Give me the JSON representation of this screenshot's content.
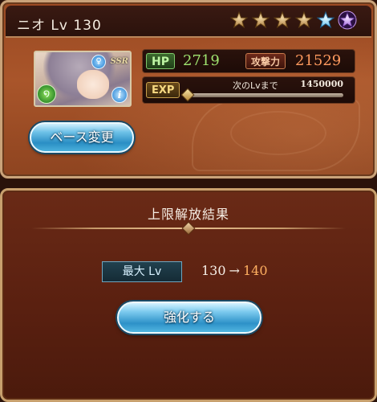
{
  "character": {
    "name": "ニオ",
    "level_label": "Lv",
    "level": "130",
    "rarity": "SSR",
    "stars": [
      {
        "kind": "bronze",
        "icon": "bronze-star-icon"
      },
      {
        "kind": "bronze",
        "icon": "bronze-star-icon"
      },
      {
        "kind": "bronze",
        "icon": "bronze-star-icon"
      },
      {
        "kind": "bronze",
        "icon": "bronze-star-icon"
      },
      {
        "kind": "blue",
        "icon": "blue-star-icon"
      },
      {
        "kind": "purple",
        "icon": "purple-star-icon"
      }
    ],
    "element_icon": "wind-element-icon",
    "gender_icon": "gender-icon",
    "info_icon": "info-icon"
  },
  "stats": {
    "hp_label": "HP",
    "hp_value": "2719",
    "atk_label": "攻撃力",
    "atk_value": "21529",
    "exp_label": "EXP",
    "next_lv_label": "次のLvまで",
    "next_lv_value": "1450000",
    "exp_progress": 0.0
  },
  "buttons": {
    "base_change": "ベース変更",
    "upgrade": "強化する"
  },
  "result": {
    "title": "上限解放結果",
    "max_lv_label": "最大 Lv",
    "from": "130",
    "arrow": "→",
    "to": "140"
  },
  "colors": {
    "panel": "#a9552a",
    "hp": "#9fe36f",
    "atk": "#ff9a5e",
    "new_level": "#ffb061",
    "button": "#2a8ec4"
  }
}
